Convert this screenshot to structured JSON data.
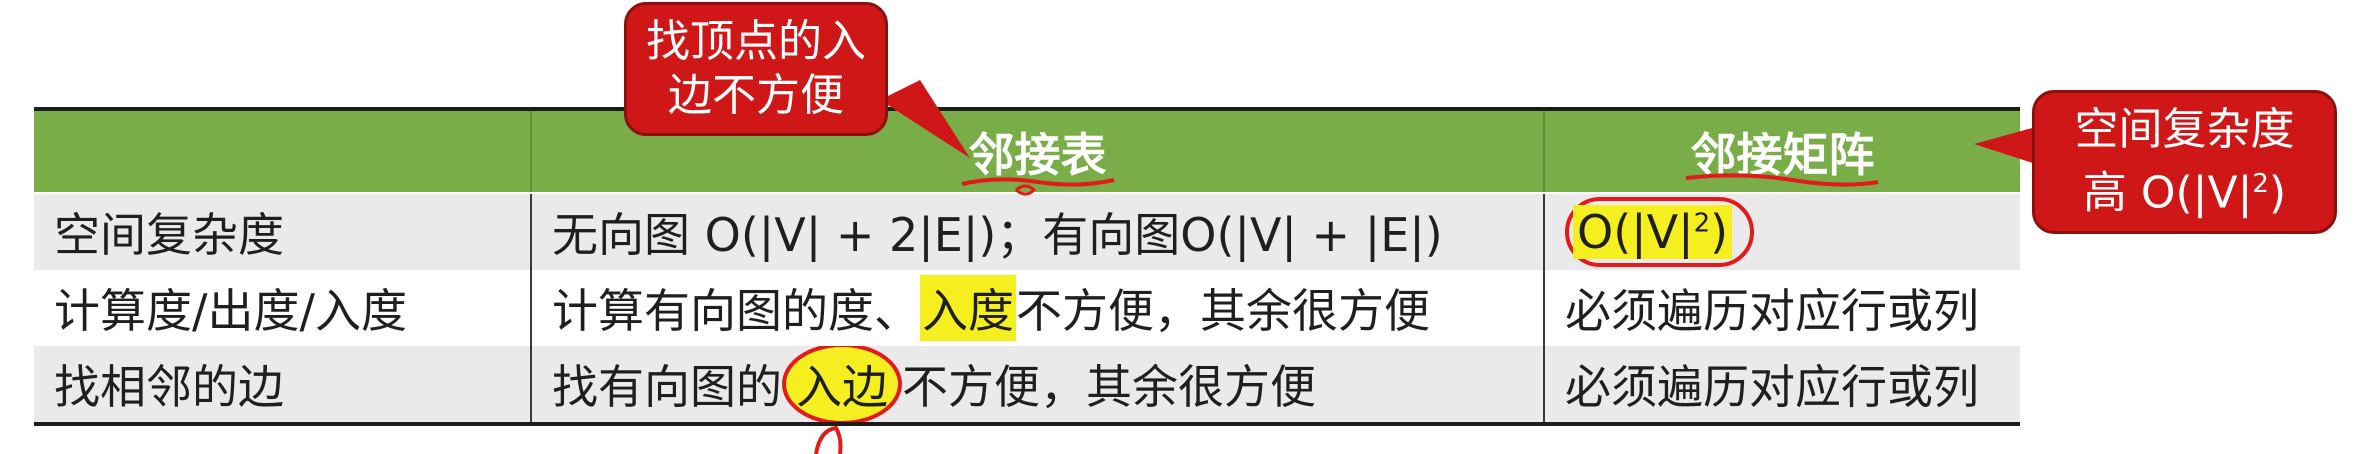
{
  "table": {
    "headers": [
      "",
      "邻接表",
      "邻接矩阵"
    ],
    "rows": [
      {
        "label": "空间复杂度",
        "adj_list": "无向图 O(|V| + 2|E|)；有向图O(|V| + |E|)",
        "adj_matrix_main": "O(|V|",
        "adj_matrix_sup": "2",
        "adj_matrix_end": ")"
      },
      {
        "label": "计算度/出度/入度",
        "adj_list_pre": "计算有向图的度、",
        "adj_list_hl": "入度",
        "adj_list_post": "不方便，其余很方便",
        "adj_matrix": "必须遍历对应行或列"
      },
      {
        "label": "找相邻的边",
        "adj_list_pre": "找有向图的",
        "adj_list_hl": "入边",
        "adj_list_post": "不方便，其余很方便",
        "adj_matrix": "必须遍历对应行或列"
      }
    ]
  },
  "callouts": {
    "left": {
      "line1": "找顶点的入",
      "line2": "边不方便"
    },
    "right": {
      "line1": "空间复杂度",
      "line2_main": "高 O(|V|",
      "line2_sup": "2",
      "line2_end": ")"
    }
  },
  "colors": {
    "header_bg": "#78ad47",
    "callout_bg": "#d01717",
    "highlight": "#f6ef1f",
    "annotation_red": "#e21a1a"
  }
}
